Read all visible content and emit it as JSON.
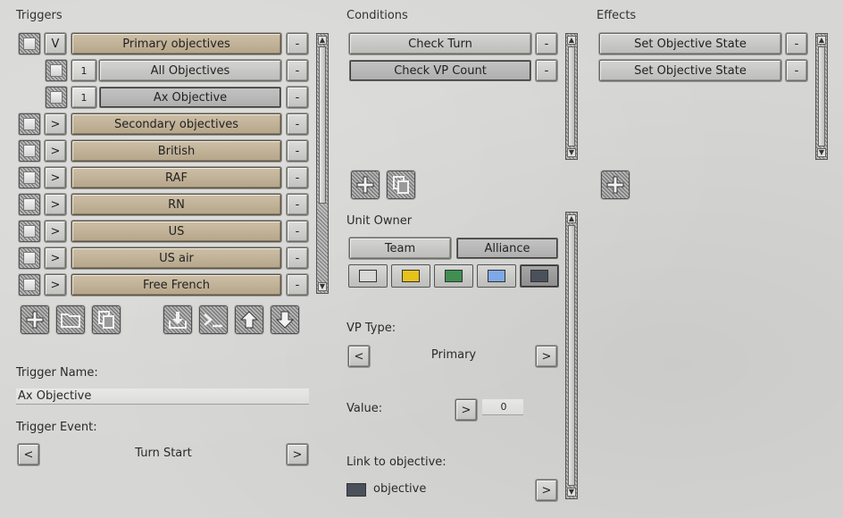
{
  "triggers": {
    "title": "Triggers",
    "rows": [
      {
        "toggle": "V",
        "label": "Primary objectives"
      },
      {
        "count": "1",
        "label": "All Objectives"
      },
      {
        "count": "1",
        "label": "Ax Objective"
      },
      {
        "toggle": ">",
        "label": "Secondary objectives"
      },
      {
        "toggle": ">",
        "label": "British"
      },
      {
        "toggle": ">",
        "label": "RAF"
      },
      {
        "toggle": ">",
        "label": "RN"
      },
      {
        "toggle": ">",
        "label": "US"
      },
      {
        "toggle": ">",
        "label": "US air"
      },
      {
        "toggle": ">",
        "label": "Free French"
      }
    ],
    "remove_label": "-",
    "toolbar_icons": [
      "plus-icon",
      "folder-icon",
      "copy-icon",
      "import-icon",
      "console-icon",
      "arrow-up-icon",
      "arrow-down-icon"
    ],
    "name_label": "Trigger Name:",
    "name_value": "Ax Objective",
    "event_label": "Trigger Event:",
    "event_value": "Turn Start",
    "prev_label": "<",
    "next_label": ">"
  },
  "conditions": {
    "title": "Conditions",
    "rows": [
      {
        "label": "Check Turn"
      },
      {
        "label": "Check VP Count"
      }
    ],
    "remove_label": "-",
    "unit_owner_label": "Unit Owner",
    "owner_tabs": [
      "Team",
      "Alliance"
    ],
    "owner_selected": "Alliance",
    "colors": [
      {
        "name": "white",
        "hex": "#d8d8d8"
      },
      {
        "name": "yellow",
        "hex": "#e6c21a"
      },
      {
        "name": "green",
        "hex": "#3f8f52"
      },
      {
        "name": "blue",
        "hex": "#7fa9e6"
      },
      {
        "name": "dark-gray",
        "hex": "#4a515b"
      }
    ],
    "selected_color": "dark-gray",
    "vp_type_label": "VP Type:",
    "vp_type_value": "Primary",
    "value_label": "Value:",
    "value_value": "0",
    "link_label": "Link to objective:",
    "link_value": "objective",
    "link_color": "#4a515b",
    "prev_label": "<",
    "next_label": ">"
  },
  "effects": {
    "title": "Effects",
    "rows": [
      {
        "label": "Set Objective State"
      },
      {
        "label": "Set Objective State"
      }
    ],
    "remove_label": "-"
  }
}
